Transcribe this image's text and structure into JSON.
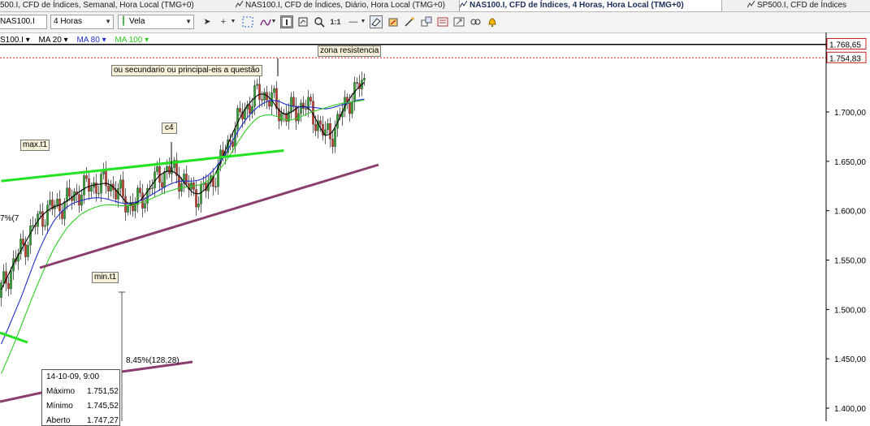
{
  "tabs": [
    {
      "label": "500.I, CFD de Índices, Semanal, Hora Local (TMG+0)",
      "active": false
    },
    {
      "label": "NAS100.I, CFD de Índices, Diário, Hora Local (TMG+0)",
      "active": false
    },
    {
      "label": "NAS100.I, CFD de Índices, 4 Horas, Hora Local (TMG+0)",
      "active": true
    },
    {
      "label": "SP500.I, CFD de Índices",
      "active": false
    }
  ],
  "toolbar": {
    "symbol": "NAS100.I",
    "timeframe": "4 Horas",
    "chart_type": "Vela",
    "ratio_label": "1:1"
  },
  "studies": {
    "volume_label": "S100.I ▾",
    "ma20_label": "MA 20 ▾",
    "ma80_label": "MA 80 ▾",
    "ma100_label": "MA 100 ▾",
    "ma20_color": "#000000",
    "ma80_color": "#1f2fd0",
    "ma100_color": "#2ecc22"
  },
  "annotations": {
    "zona": "zona resistencia",
    "question": "ou secundario ou principal-eis a questão",
    "c4": "c4",
    "max": "max.t1",
    "min": "min.t1",
    "percent": "8,45%(128,28)",
    "left_pct": "7%(7"
  },
  "tooltip": {
    "date": "14-10-09, 9:00",
    "rows": [
      {
        "label": "Máximo",
        "value": "1.751,52"
      },
      {
        "label": "Mínimo",
        "value": "1.745,52"
      },
      {
        "label": "Aberto",
        "value": "1.747,27"
      }
    ]
  },
  "colors": {
    "up": "#2e9d2e",
    "down": "#c0392b",
    "trend_green": "#22e322",
    "trend_purple": "#8a3d6e",
    "resistance_dotted": "#cc2222",
    "price_tag_border": "#cc2222"
  },
  "chart_data": {
    "type": "line",
    "title": "",
    "ylim": [
      1395,
      1770
    ],
    "yticks": [
      {
        "value": 1700,
        "label": "1.700,00"
      },
      {
        "value": 1650,
        "label": "1.650,00"
      },
      {
        "value": 1600,
        "label": "1.600,00"
      },
      {
        "value": 1550,
        "label": "1.550,00"
      },
      {
        "value": 1500,
        "label": "1.500,00"
      },
      {
        "value": 1450,
        "label": "1.450,00"
      },
      {
        "value": 1400,
        "label": "1.400,00"
      }
    ],
    "price_tags": [
      {
        "value": 1768.65,
        "label": "1.768,65"
      },
      {
        "value": 1754.83,
        "label": "1.754,83"
      }
    ],
    "bar_count": 150,
    "series": [
      {
        "name": "MA 20",
        "values": [
          1520,
          1534,
          1548,
          1560,
          1572,
          1584,
          1594,
          1600,
          1604,
          1606,
          1610,
          1615,
          1620,
          1624,
          1626,
          1627,
          1628,
          1624,
          1616,
          1608,
          1606,
          1610,
          1618,
          1628,
          1636,
          1640,
          1640,
          1635,
          1626,
          1618,
          1617,
          1622,
          1632,
          1645,
          1662,
          1678,
          1692,
          1704,
          1712,
          1718,
          1718,
          1712,
          1702,
          1697,
          1700,
          1705,
          1706,
          1701,
          1688,
          1676,
          1678,
          1690,
          1705,
          1716,
          1724,
          1730
        ]
      },
      {
        "name": "MA 80",
        "values": [
          1465,
          1480,
          1496,
          1512,
          1530,
          1548,
          1564,
          1578,
          1590,
          1598,
          1604,
          1608,
          1610,
          1612,
          1613,
          1613,
          1612,
          1610,
          1608,
          1607,
          1608,
          1610,
          1613,
          1617,
          1621,
          1625,
          1628,
          1630,
          1630,
          1630,
          1631,
          1634,
          1640,
          1648,
          1658,
          1670,
          1682,
          1692,
          1700,
          1706,
          1710,
          1712,
          1711,
          1708,
          1706,
          1705,
          1705,
          1705,
          1704,
          1703,
          1704,
          1706,
          1708,
          1710,
          1712,
          1713
        ]
      },
      {
        "name": "MA 100",
        "values": [
          1435,
          1450,
          1466,
          1483,
          1500,
          1517,
          1533,
          1548,
          1562,
          1573,
          1583,
          1590,
          1596,
          1600,
          1603,
          1605,
          1606,
          1606,
          1605,
          1605,
          1606,
          1608,
          1610,
          1613,
          1616,
          1619,
          1621,
          1623,
          1624,
          1625,
          1626,
          1629,
          1634,
          1641,
          1650,
          1660,
          1671,
          1681,
          1689,
          1695,
          1697,
          1697,
          1695,
          1692,
          1692,
          1694,
          1697,
          1700,
          1702,
          1704,
          1706,
          1708,
          1709,
          1710,
          1711,
          1712
        ]
      }
    ],
    "trendlines": [
      {
        "name": "green-upper",
        "from": [
          0,
          1630
        ],
        "to": [
          136,
          1662
        ]
      },
      {
        "name": "purple-lower",
        "from": [
          18,
          1550
        ],
        "to": [
          175,
          1646
        ]
      }
    ],
    "resistance_level": 1754.83
  }
}
